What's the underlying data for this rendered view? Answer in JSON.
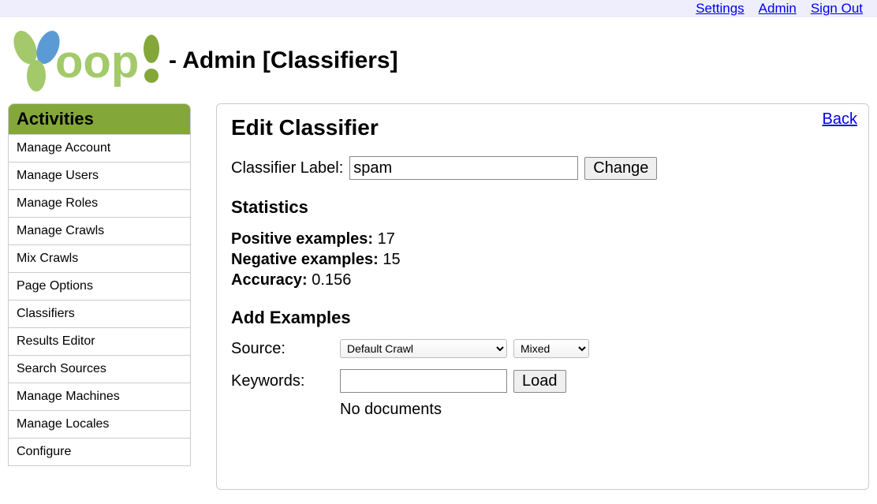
{
  "topnav": {
    "settings": "Settings",
    "admin": "Admin",
    "signout": "Sign Out"
  },
  "header": {
    "title_suffix": "- Admin [Classifiers]"
  },
  "sidebar": {
    "title": "Activities",
    "items": [
      "Manage Account",
      "Manage Users",
      "Manage Roles",
      "Manage Crawls",
      "Mix Crawls",
      "Page Options",
      "Classifiers",
      "Results Editor",
      "Search Sources",
      "Manage Machines",
      "Manage Locales",
      "Configure"
    ]
  },
  "main": {
    "back": "Back",
    "heading": "Edit Classifier",
    "classifier_label_text": "Classifier Label:",
    "classifier_label_value": "spam",
    "change_btn": "Change",
    "stats_heading": "Statistics",
    "stats": {
      "pos_label": "Positive examples:",
      "pos_value": "17",
      "neg_label": "Negative examples:",
      "neg_value": "15",
      "acc_label": "Accuracy:",
      "acc_value": "0.156"
    },
    "add_heading": "Add Examples",
    "source_label": "Source:",
    "source_value": "Default Crawl",
    "mixed_value": "Mixed",
    "keywords_label": "Keywords:",
    "keywords_value": "",
    "load_btn": "Load",
    "no_docs": "No documents"
  }
}
